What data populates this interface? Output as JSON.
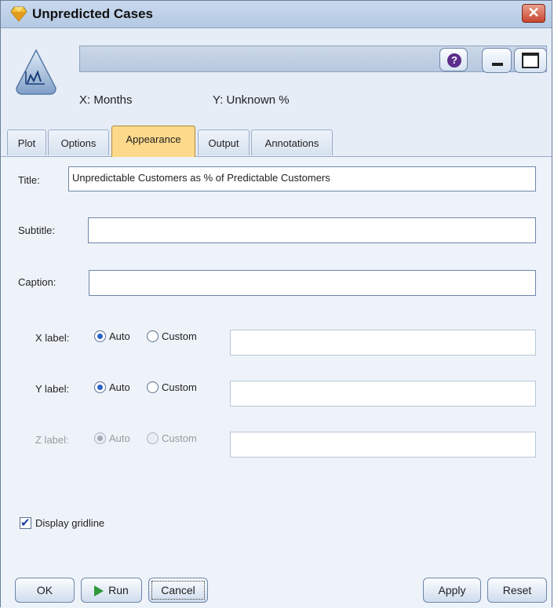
{
  "window": {
    "title": "Unpredicted Cases",
    "close_glyph": "✕"
  },
  "header": {
    "node_name": "",
    "help_glyph": "?",
    "x_info": "X: Months",
    "y_info": "Y: Unknown %"
  },
  "tabs": [
    {
      "label": "Plot",
      "active": false
    },
    {
      "label": "Options",
      "active": false
    },
    {
      "label": "Appearance",
      "active": true
    },
    {
      "label": "Output",
      "active": false
    },
    {
      "label": "Annotations",
      "active": false
    }
  ],
  "form": {
    "title_label": "Title:",
    "title_value": "Unpredictable Customers as % of Predictable Customers",
    "subtitle_label": "Subtitle:",
    "subtitle_value": "",
    "caption_label": "Caption:",
    "caption_value": "",
    "xlabel": {
      "label": "X label:",
      "auto": "Auto",
      "custom": "Custom",
      "selected": "Auto",
      "custom_value": ""
    },
    "ylabel": {
      "label": "Y label:",
      "auto": "Auto",
      "custom": "Custom",
      "selected": "Auto",
      "custom_value": ""
    },
    "zlabel": {
      "label": "Z label:",
      "auto": "Auto",
      "custom": "Custom",
      "selected": "Auto",
      "custom_value": "",
      "disabled": true
    },
    "gridline": {
      "label": "Display gridline",
      "checked": true
    }
  },
  "buttons": {
    "ok": "OK",
    "run": "Run",
    "cancel": "Cancel",
    "apply": "Apply",
    "reset": "Reset"
  },
  "colors": {
    "active_tab": "#fcd98b",
    "close": "#c8452e",
    "run_icon": "#2f9a3a"
  }
}
